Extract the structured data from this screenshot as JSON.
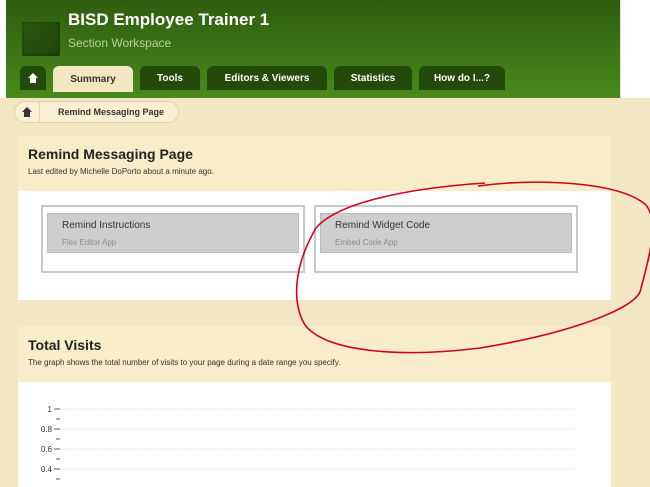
{
  "header": {
    "title": "BISD Employee Trainer 1",
    "subtitle": "Section Workspace",
    "logo_icon": "section-logo-icon"
  },
  "tabs": [
    {
      "label": "",
      "icon": "home-icon"
    },
    {
      "label": "Summary",
      "active": true
    },
    {
      "label": "Tools"
    },
    {
      "label": "Editors & Viewers"
    },
    {
      "label": "Statistics"
    },
    {
      "label": "How do I...?"
    }
  ],
  "breadcrumb": {
    "home_icon": "home-icon",
    "current": "Remind Messaging Page"
  },
  "page": {
    "title": "Remind Messaging Page",
    "meta": "Last edited by Michelle DoPorto about a minute ago.",
    "apps": [
      {
        "name": "Remind Instructions",
        "type": "Flex Editor App"
      },
      {
        "name": "Remind Widget Code",
        "type": "Embed Code App"
      }
    ]
  },
  "visits": {
    "title": "Total Visits",
    "description": "The graph shows the total number of visits to your page during a date range you specify."
  },
  "chart_data": {
    "type": "line",
    "y_ticks": [
      "1",
      "0.8",
      "0.6",
      "0.4"
    ],
    "ylim": [
      0.4,
      1
    ],
    "grid": true,
    "series": []
  },
  "colors": {
    "header_green": "#3d7515",
    "tab_dark": "#244a0a",
    "panel_tan": "#f8ecc9",
    "annotation_red": "#d0021b"
  }
}
